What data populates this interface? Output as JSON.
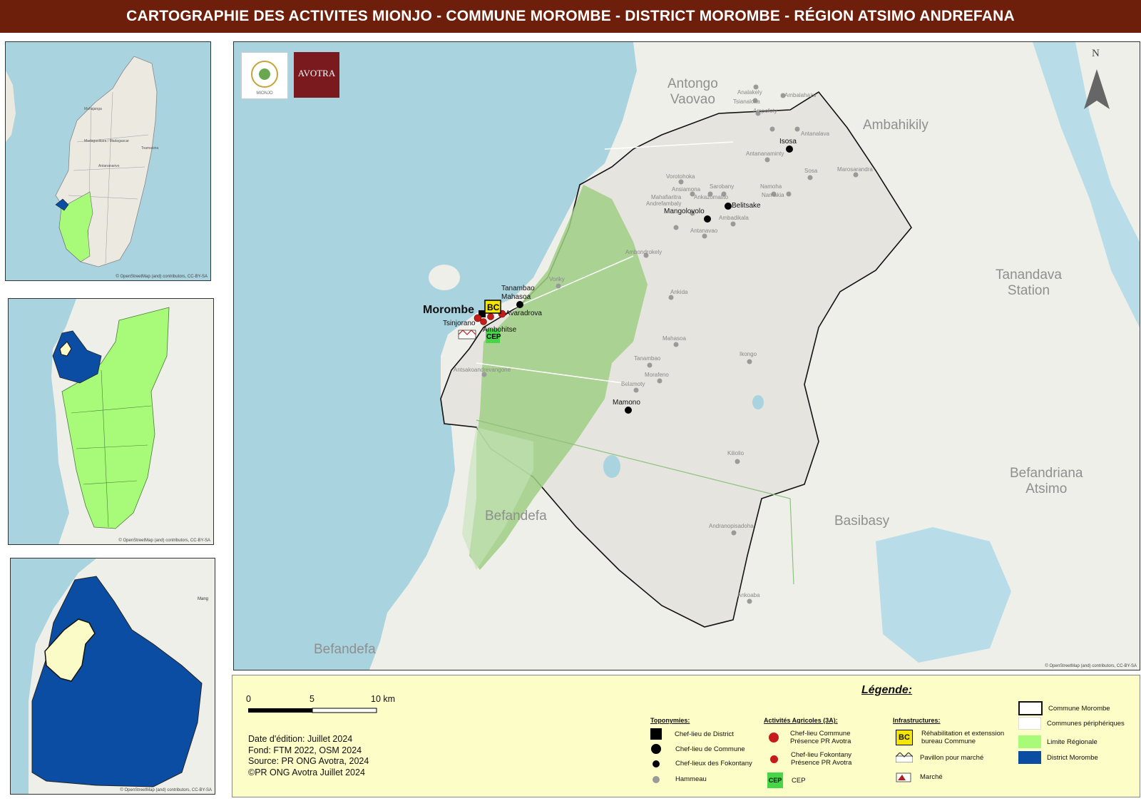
{
  "title": "CARTOGRAPHIE DES ACTIVITES MIONJO -  COMMUNE MOROMBE - DISTRICT MOROMBE - RÉGION ATSIMO ANDREFANA",
  "colors": {
    "title_bg": "#6e1f0b",
    "sea": "#a9d3df",
    "land": "#efefe9",
    "commune_fill": "#e6e4de",
    "park_green": "#9fcf85",
    "region_green": "#a8fb78",
    "district_blue": "#0a4da3",
    "commune_pale": "#fbfbc8",
    "legend_bg": "#fdfdc7"
  },
  "insets": {
    "inset1": {
      "labels": [
        "Mahajanga",
        "Madagasikara / Madagascar",
        "Toamasina",
        "Antananarivo"
      ],
      "attribution": "© OpenStreetMap (and) contributors, CC-BY-SA"
    },
    "inset2": {
      "attribution": "© OpenStreetMap (and) contributors, CC-BY-SA"
    },
    "inset3": {
      "labels": [
        "Mang"
      ],
      "attribution": "© OpenStreetMap (and) contributors, CC-BY-SA"
    }
  },
  "map": {
    "logos": {
      "mionjo": "MIONJO",
      "avotra": "AVOTRA"
    },
    "north_label": "N",
    "attribution": "© OpenStreetMap (and) contributors, CC-BY-SA",
    "region_labels": {
      "antongo": "Antongo\nVaovao",
      "ambahikily": "Ambahikily",
      "tanandava": "Tanandava\nStation",
      "befandriana": "Befandriana\nAtsimo",
      "basibasy": "Basibasy",
      "befandefa1": "Befandefa",
      "befandefa2": "Befandefa"
    },
    "district": "Morombe",
    "communes": [
      "Isosa",
      "Belitsake",
      "Mangolovolo",
      "Mamono",
      "Tanambao\nMahasoa",
      "Avaradrova",
      "Tsinjorano",
      "Ambohitse"
    ],
    "hamlets": [
      "Analakely",
      "Ambalahazo",
      "Tsianaloka",
      "Ampofoty",
      "Antanalava",
      "Antananaminty",
      "Sosa",
      "Marosarandra",
      "Vorotohoka",
      "Sarobany",
      "Ansiamona",
      "Mahafiaritra",
      "Ankazomalito",
      "Namoha",
      "Andrefambaly",
      "Namakia",
      "Ambadikala",
      "Antanavao",
      "Ambondrokely",
      "Ankida",
      "Mahasoa",
      "Ikongo",
      "Tanambao",
      "Morafeno",
      "Belamoty",
      "Kiliolio",
      "Andranopisadoha",
      "Ankoaba",
      "Antsakoandrevangone",
      "Voriky"
    ]
  },
  "scale": {
    "ticks": [
      "0",
      "5",
      "10 km"
    ]
  },
  "notes": [
    "Date d'édition: Juillet 2024",
    "Fond: FTM 2022, OSM 2024",
    "Source: PR ONG Avotra, 2024",
    "©PR ONG Avotra Juillet 2024"
  ],
  "legend": {
    "title": "Légende:",
    "toponymies": {
      "header": "Toponymies:",
      "items": [
        "Chef-lieu de District",
        "Chef-lieu de Commune",
        "Chef-lieux des Fokontany",
        "Hammeau"
      ]
    },
    "activites": {
      "header": "Activités Agricoles (3A):",
      "items": [
        "Chef-lieu Commune\nPrésence PR Avotra",
        "Chef-lieu Fokontany\nPrésence PR Avotra",
        "CEP"
      ]
    },
    "infrastructures": {
      "header": "Infrastructures:",
      "items": [
        "Réhabilitation et extenssion\nbureau Commune",
        "Pavillon pour marché",
        "Marché"
      ]
    },
    "limites": {
      "items": [
        "Commune Morombe",
        "Communes périphériques",
        "Limite Régionale",
        "District Morombe"
      ]
    },
    "symbols": {
      "bc": "BC",
      "cep": "CEP"
    }
  }
}
